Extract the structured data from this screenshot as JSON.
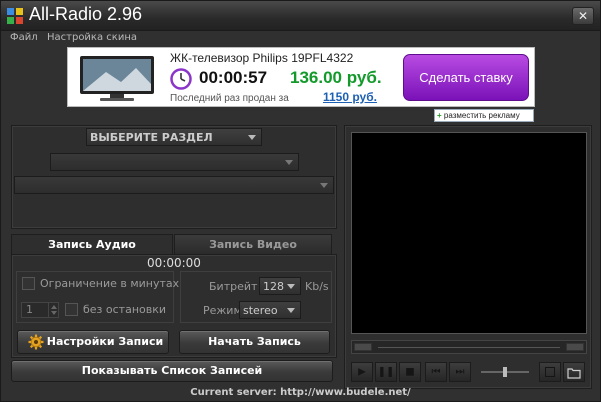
{
  "window": {
    "title": "All-Radio 2.96",
    "close_glyph": "✕"
  },
  "menu": [
    "Файл",
    "Настройка скина"
  ],
  "ad": {
    "product": "ЖК-телевизор Philips 19PFL4322",
    "timer": "00:00:57",
    "price": "136.00 руб.",
    "last_sold_label": "Последний раз продан за",
    "last_sold_price": "1150 руб.",
    "bid_button": "Сделать ставку",
    "place_ad_plus": "+",
    "place_ad": "разместить рекламу"
  },
  "section": {
    "select_label": "ВЫБЕРИТЕ РАЗДЕЛ",
    "subselect_value": "",
    "station_value": ""
  },
  "tabs": {
    "audio": "Запись Аудио",
    "video": "Запись Видео"
  },
  "record": {
    "timer": "00:00:00",
    "limit_minutes_label": "Ограничение в минутах",
    "limit_value": "1",
    "nonstop_label": "без остановки",
    "bitrate_label": "Битрейт",
    "bitrate_value": "128",
    "bitrate_unit": "Kb/s",
    "mode_label": "Режим",
    "mode_value": "stereo",
    "settings_button": "Настройки Записи",
    "start_button": "Начать Запись"
  },
  "show_list_button": "Показывать Список Записей",
  "status": "Current server: http://www.budele.net/",
  "icons": {
    "play": "▶",
    "pause": "❚❚",
    "stop": "■",
    "prev": "⏮",
    "next": "⏭"
  },
  "colors": {
    "price_green": "#139a2a",
    "bid_purple": "#9b2fd0",
    "link_blue": "#1c5fb3"
  }
}
